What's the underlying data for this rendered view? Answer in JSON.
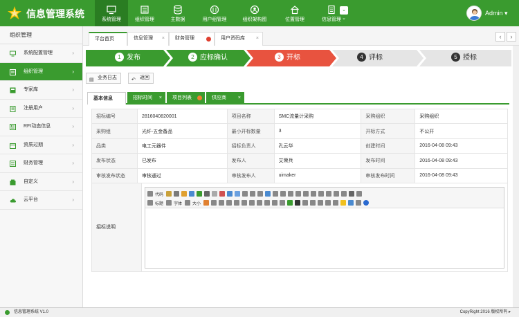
{
  "app": {
    "title": "信息管理系统",
    "user": "Admin",
    "more_symbol": "⌄"
  },
  "colors": {
    "primary": "#3a9b2f",
    "primary_dark": "#2a7d22",
    "step_active": "#e8533f",
    "step_done": "#3a9b2f",
    "step_todo": "#e5e5e5"
  },
  "topnav": [
    {
      "label": "系统管理",
      "icon": "monitor-icon"
    },
    {
      "label": "组织管理",
      "icon": "list-icon"
    },
    {
      "label": "主数据",
      "icon": "database-icon"
    },
    {
      "label": "用户组管理",
      "icon": "user-group-icon"
    },
    {
      "label": "组织架构图",
      "icon": "org-chart-icon"
    },
    {
      "label": "位置管理",
      "icon": "home-icon"
    },
    {
      "label": "信息管理",
      "icon": "document-icon"
    }
  ],
  "sidebar": {
    "header": "组织管理",
    "items": [
      {
        "label": "系统配置管理",
        "icon": "monitor-icon"
      },
      {
        "label": "组织管理",
        "icon": "list-icon"
      },
      {
        "label": "专家库",
        "icon": "book-icon"
      },
      {
        "label": "注册用户",
        "icon": "doc-icon"
      },
      {
        "label": "RFI动态信息",
        "icon": "news-icon"
      },
      {
        "label": "资质过期",
        "icon": "calendar-icon"
      },
      {
        "label": "财务管理",
        "icon": "finance-icon"
      },
      {
        "label": "自定义",
        "icon": "edit-icon"
      },
      {
        "label": "云平台",
        "icon": "cloud-icon"
      }
    ]
  },
  "page_tabs": [
    {
      "label": "平台首页",
      "close": ""
    },
    {
      "label": "信息管理",
      "close": "×"
    },
    {
      "label": "财务管理",
      "close": ""
    },
    {
      "label": "用户资码库",
      "close": "×"
    }
  ],
  "tab_nav": {
    "prev": "‹",
    "next": "›"
  },
  "steps": [
    {
      "num": "1",
      "label": "发布"
    },
    {
      "num": "2",
      "label": "应标确认"
    },
    {
      "num": "3",
      "label": "开标"
    },
    {
      "num": "4",
      "label": "评标"
    },
    {
      "num": "5",
      "label": "授标"
    }
  ],
  "toolbar": {
    "log": "业务日志",
    "back": "返回",
    "log_icon": "▤",
    "back_icon": "↶"
  },
  "inner_tabs": [
    {
      "label": "基本信息",
      "close": ""
    },
    {
      "label": "招标时间",
      "close": "×"
    },
    {
      "label": "项目列表",
      "close": ""
    },
    {
      "label": "供应商",
      "close": "×"
    }
  ],
  "info_rows": [
    [
      "招标编号",
      "2816040820001",
      "项目名称",
      "SMC流量计采购",
      "采购组织",
      "采购组织"
    ],
    [
      "采购组",
      "光纤-五金备品",
      "最小开标数量",
      "3",
      "开标方式",
      "不公开"
    ],
    [
      "品类",
      "电工元器件",
      "招标负责人",
      "孔云华",
      "创建时间",
      "2016-04-08 09:43"
    ],
    [
      "发布状态",
      "已发布",
      "发布人",
      "艾荣兵",
      "发布时间",
      "2016-04-08 09:43"
    ],
    [
      "审核发布状态",
      "审核通过",
      "审核发布人",
      "uimaker",
      "审核发布时间",
      "2016-04-08 09:43"
    ]
  ],
  "editor": {
    "label": "招标说明",
    "code": "代码",
    "title": "标题",
    "font": "字体",
    "size": "大小"
  },
  "footer": {
    "left": "信息管理系统 V1.0",
    "right": "CopyRight 2016  版权所有 ▸"
  }
}
